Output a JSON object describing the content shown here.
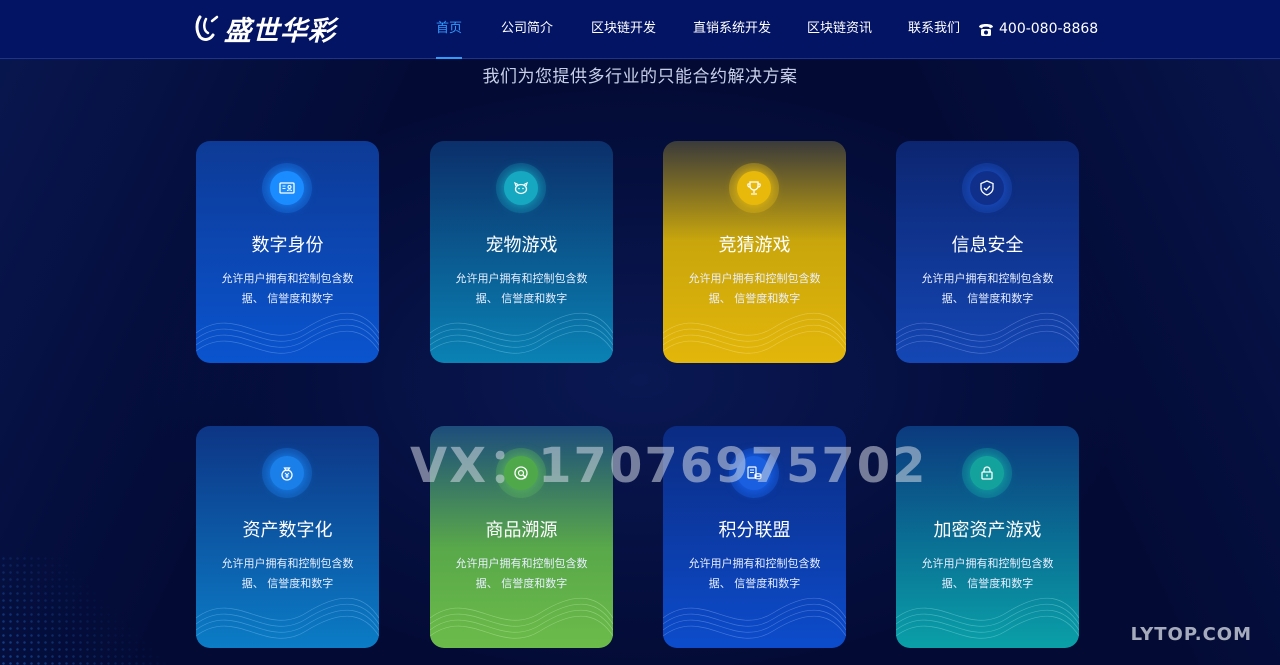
{
  "header": {
    "logo_text": "盛世华彩",
    "nav": [
      {
        "label": "首页",
        "active": true
      },
      {
        "label": "公司简介",
        "active": false
      },
      {
        "label": "区块链开发",
        "active": false
      },
      {
        "label": "直销系统开发",
        "active": false
      },
      {
        "label": "区块链资讯",
        "active": false
      },
      {
        "label": "联系我们",
        "active": false
      }
    ],
    "phone": "400-080-8868",
    "phone_icon": "telephone-icon"
  },
  "subtitle": "我们为您提供多行业的只能合约解决方案",
  "cards": [
    {
      "title": "数字身份",
      "desc": "允许用户拥有和控制包含数据、 信誉度和数字",
      "icon": "id-card-icon",
      "accent": "#1a8cff"
    },
    {
      "title": "宠物游戏",
      "desc": "允许用户拥有和控制包含数据、 信誉度和数字",
      "icon": "pet-icon",
      "accent": "#17b3c9"
    },
    {
      "title": "竞猜游戏",
      "desc": "允许用户拥有和控制包含数据、 信誉度和数字",
      "icon": "trophy-icon",
      "accent": "#f1c40f"
    },
    {
      "title": "信息安全",
      "desc": "允许用户拥有和控制包含数据、 信誉度和数字",
      "icon": "shield-check-icon",
      "accent": "#1c52c8"
    },
    {
      "title": "资产数字化",
      "desc": "允许用户拥有和控制包含数据、 信誉度和数字",
      "icon": "money-bag-icon",
      "accent": "#1a8cff"
    },
    {
      "title": "商品溯源",
      "desc": "允许用户拥有和控制包含数据、 信誉度和数字",
      "icon": "trace-icon",
      "accent": "#5cb85c"
    },
    {
      "title": "积分联盟",
      "desc": "允许用户拥有和控制包含数据、 信誉度和数字",
      "icon": "coins-icon",
      "accent": "#1a6cff"
    },
    {
      "title": "加密资产游戏",
      "desc": "允许用户拥有和控制包含数据、 信誉度和数字",
      "icon": "lock-icon",
      "accent": "#15b0a8"
    }
  ],
  "watermark": "VX：17076975702",
  "brand_mark": "LYTOP.COM"
}
